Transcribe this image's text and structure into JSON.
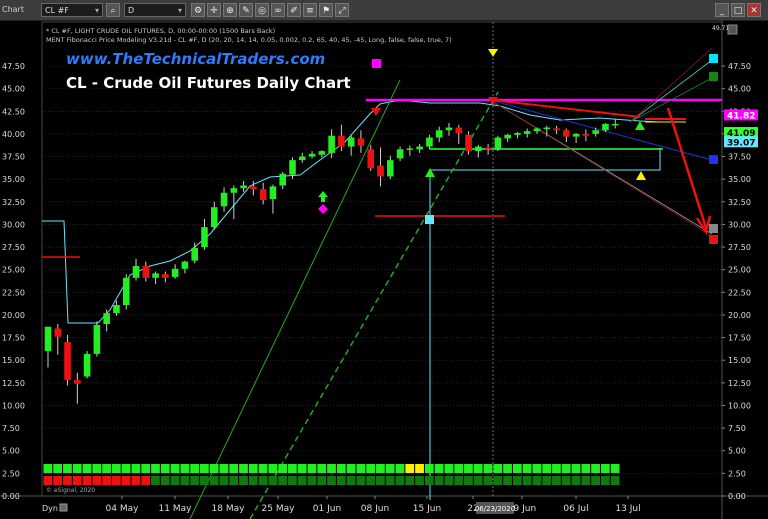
{
  "toolbar": {
    "window_label": "Chart",
    "symbol": "CL #F",
    "interval": "D",
    "minimize": "_",
    "maximize": "□",
    "close": "✕"
  },
  "overlay": {
    "website": "www.TheTechnicalTraders.com",
    "title": "CL - Crude Oil Futures Daily Chart",
    "header_line1": "* CL #F, LIGHT CRUDE OIL FUTURES, D, 00:00-00:00 (1500 Bars Back)",
    "header_line2": "MENT Fibonacci Price Modeling V3.21d - CL #F, D (20, 20, 14, 14, 0.05, 0.002, 0.2, 65, 40, 45, -45, Long, false, false, true, 7)",
    "copyright": "© eSignal, 2020",
    "date_tag": "06/23/2020",
    "dyn_label": "Dyn"
  },
  "price_axis": {
    "top_value": "49.71",
    "ticks": [
      "47.50",
      "45.00",
      "42.50",
      "40.00",
      "37.50",
      "35.00",
      "32.50",
      "30.00",
      "27.50",
      "25.00",
      "22.50",
      "20.00",
      "17.50",
      "15.00",
      "12.50",
      "10.00",
      "7.50",
      "5.00",
      "2.50",
      "0.00"
    ],
    "badges": [
      {
        "text": "41.82",
        "color": "#ff00ff",
        "text_color": "#ffffff"
      },
      {
        "text": "41.09",
        "color": "#33ff33",
        "text_color": "#000000"
      },
      {
        "text": "39.07",
        "color": "#66e6ff",
        "text_color": "#000000"
      }
    ]
  },
  "chart_data": {
    "type": "candlestick",
    "ylim": [
      0,
      49.71
    ],
    "x_ticks": [
      "04 May",
      "11 May",
      "18 May",
      "25 May",
      "01 Jun",
      "08 Jun",
      "15 Jun",
      "22",
      "29 Jun",
      "06 Jul",
      "13 Jul"
    ],
    "candles": [
      {
        "o": 16.0,
        "h": 18.0,
        "c": 18.7,
        "l": 14.2
      },
      {
        "o": 18.5,
        "h": 19.0,
        "c": 17.6,
        "l": 15.6
      },
      {
        "o": 17.0,
        "h": 17.8,
        "c": 12.8,
        "l": 12.2
      },
      {
        "o": 12.8,
        "h": 13.6,
        "c": 12.4,
        "l": 10.2
      },
      {
        "o": 13.2,
        "h": 16.0,
        "c": 15.7,
        "l": 13.0
      },
      {
        "o": 15.7,
        "h": 19.3,
        "c": 18.9,
        "l": 15.4
      },
      {
        "o": 19.0,
        "h": 20.6,
        "c": 20.2,
        "l": 18.2
      },
      {
        "o": 20.2,
        "h": 21.6,
        "c": 21.1,
        "l": 19.9
      },
      {
        "o": 21.1,
        "h": 24.5,
        "c": 24.1,
        "l": 20.6
      },
      {
        "o": 24.1,
        "h": 26.2,
        "c": 25.4,
        "l": 23.8
      },
      {
        "o": 25.4,
        "h": 25.9,
        "c": 24.1,
        "l": 23.7
      },
      {
        "o": 24.1,
        "h": 24.8,
        "c": 24.6,
        "l": 23.4
      },
      {
        "o": 24.5,
        "h": 24.8,
        "c": 24.1,
        "l": 23.6
      },
      {
        "o": 24.2,
        "h": 25.6,
        "c": 25.1,
        "l": 24.0
      },
      {
        "o": 25.1,
        "h": 26.0,
        "c": 25.9,
        "l": 24.6
      },
      {
        "o": 26.0,
        "h": 28.0,
        "c": 27.4,
        "l": 25.7
      },
      {
        "o": 27.5,
        "h": 30.6,
        "c": 29.7,
        "l": 27.2
      },
      {
        "o": 29.7,
        "h": 32.5,
        "c": 31.9,
        "l": 29.4
      },
      {
        "o": 32.0,
        "h": 34.1,
        "c": 33.5,
        "l": 31.4
      },
      {
        "o": 33.5,
        "h": 34.3,
        "c": 34.0,
        "l": 30.6
      },
      {
        "o": 34.0,
        "h": 34.8,
        "c": 34.3,
        "l": 33.6
      },
      {
        "o": 34.2,
        "h": 34.8,
        "c": 33.9,
        "l": 33.2
      },
      {
        "o": 33.9,
        "h": 34.6,
        "c": 32.7,
        "l": 32.2
      },
      {
        "o": 32.8,
        "h": 34.4,
        "c": 34.2,
        "l": 31.2
      },
      {
        "o": 34.3,
        "h": 35.8,
        "c": 35.6,
        "l": 33.9
      },
      {
        "o": 35.5,
        "h": 37.4,
        "c": 37.1,
        "l": 35.0
      },
      {
        "o": 37.1,
        "h": 37.9,
        "c": 37.5,
        "l": 36.8
      },
      {
        "o": 37.5,
        "h": 38.1,
        "c": 37.8,
        "l": 37.3
      },
      {
        "o": 37.7,
        "h": 38.2,
        "c": 38.1,
        "l": 37.4
      },
      {
        "o": 37.9,
        "h": 40.5,
        "c": 39.8,
        "l": 37.3
      },
      {
        "o": 39.8,
        "h": 41.0,
        "c": 38.6,
        "l": 38.1
      },
      {
        "o": 38.6,
        "h": 39.8,
        "c": 39.6,
        "l": 37.6
      },
      {
        "o": 39.5,
        "h": 40.4,
        "c": 38.7,
        "l": 37.9
      },
      {
        "o": 38.3,
        "h": 38.8,
        "c": 36.2,
        "l": 35.9
      },
      {
        "o": 36.5,
        "h": 38.5,
        "c": 35.3,
        "l": 34.2
      },
      {
        "o": 35.3,
        "h": 37.6,
        "c": 37.1,
        "l": 35.0
      },
      {
        "o": 37.3,
        "h": 38.6,
        "c": 38.3,
        "l": 37.0
      },
      {
        "o": 38.3,
        "h": 38.7,
        "c": 38.4,
        "l": 37.6
      },
      {
        "o": 38.3,
        "h": 38.9,
        "c": 38.6,
        "l": 37.9
      },
      {
        "o": 38.6,
        "h": 39.9,
        "c": 39.6,
        "l": 38.3
      },
      {
        "o": 39.6,
        "h": 40.8,
        "c": 40.4,
        "l": 39.1
      },
      {
        "o": 40.4,
        "h": 41.2,
        "c": 40.7,
        "l": 39.8
      },
      {
        "o": 40.7,
        "h": 41.0,
        "c": 40.1,
        "l": 38.9
      },
      {
        "o": 39.9,
        "h": 40.3,
        "c": 38.1,
        "l": 37.7
      },
      {
        "o": 38.1,
        "h": 38.8,
        "c": 38.6,
        "l": 37.4
      },
      {
        "o": 38.5,
        "h": 38.9,
        "c": 38.3,
        "l": 37.7
      },
      {
        "o": 38.4,
        "h": 39.8,
        "c": 39.6,
        "l": 38.1
      },
      {
        "o": 39.5,
        "h": 40.0,
        "c": 39.9,
        "l": 39.1
      },
      {
        "o": 39.9,
        "h": 40.2,
        "c": 40.1,
        "l": 39.5
      },
      {
        "o": 40.0,
        "h": 40.6,
        "c": 40.3,
        "l": 39.6
      },
      {
        "o": 40.3,
        "h": 40.7,
        "c": 40.6,
        "l": 40.0
      },
      {
        "o": 40.6,
        "h": 40.9,
        "c": 40.7,
        "l": 39.7
      },
      {
        "o": 40.6,
        "h": 40.9,
        "c": 40.4,
        "l": 40.0
      },
      {
        "o": 40.4,
        "h": 40.6,
        "c": 39.7,
        "l": 39.1
      },
      {
        "o": 39.7,
        "h": 40.1,
        "c": 40.0,
        "l": 39.0
      },
      {
        "o": 40.0,
        "h": 40.5,
        "c": 39.8,
        "l": 39.2
      },
      {
        "o": 40.0,
        "h": 40.7,
        "c": 40.4,
        "l": 39.7
      },
      {
        "o": 40.4,
        "h": 41.2,
        "c": 41.1,
        "l": 40.2
      },
      {
        "o": 41.0,
        "h": 41.6,
        "c": 41.1,
        "l": 40.6
      }
    ],
    "bottom_strips": {
      "top_colors": [
        "g",
        "g",
        "g",
        "g",
        "g",
        "g",
        "g",
        "g",
        "g",
        "g",
        "g",
        "g",
        "g",
        "g",
        "g",
        "g",
        "g",
        "g",
        "g",
        "g",
        "g",
        "g",
        "g",
        "g",
        "g",
        "g",
        "g",
        "g",
        "g",
        "g",
        "g",
        "g",
        "g",
        "g",
        "g",
        "g",
        "g",
        "y",
        "y",
        "g",
        "g",
        "g",
        "g",
        "g",
        "g",
        "g",
        "g",
        "g",
        "g",
        "g",
        "g",
        "g",
        "g",
        "g",
        "g",
        "g",
        "g",
        "g",
        "g"
      ],
      "bottom_colors": [
        "r",
        "r",
        "r",
        "r",
        "r",
        "r",
        "r",
        "r",
        "r",
        "r",
        "r",
        "d",
        "d",
        "d",
        "d",
        "d",
        "d",
        "d",
        "d",
        "d",
        "d",
        "d",
        "d",
        "d",
        "d",
        "d",
        "d",
        "d",
        "d",
        "d",
        "d",
        "d",
        "d",
        "d",
        "d",
        "d",
        "d",
        "d",
        "d",
        "d",
        "d",
        "d",
        "d",
        "d",
        "d",
        "d",
        "d",
        "d",
        "d",
        "d",
        "d",
        "d",
        "d",
        "d",
        "d",
        "d",
        "d",
        "d",
        "d"
      ]
    }
  },
  "colors": {
    "up": "#22ee22",
    "down": "#ee1111",
    "magenta": "#ff00ff",
    "cyan": "#66e6ff",
    "yellow": "#ffee00",
    "grid": "#3a3a3a"
  }
}
